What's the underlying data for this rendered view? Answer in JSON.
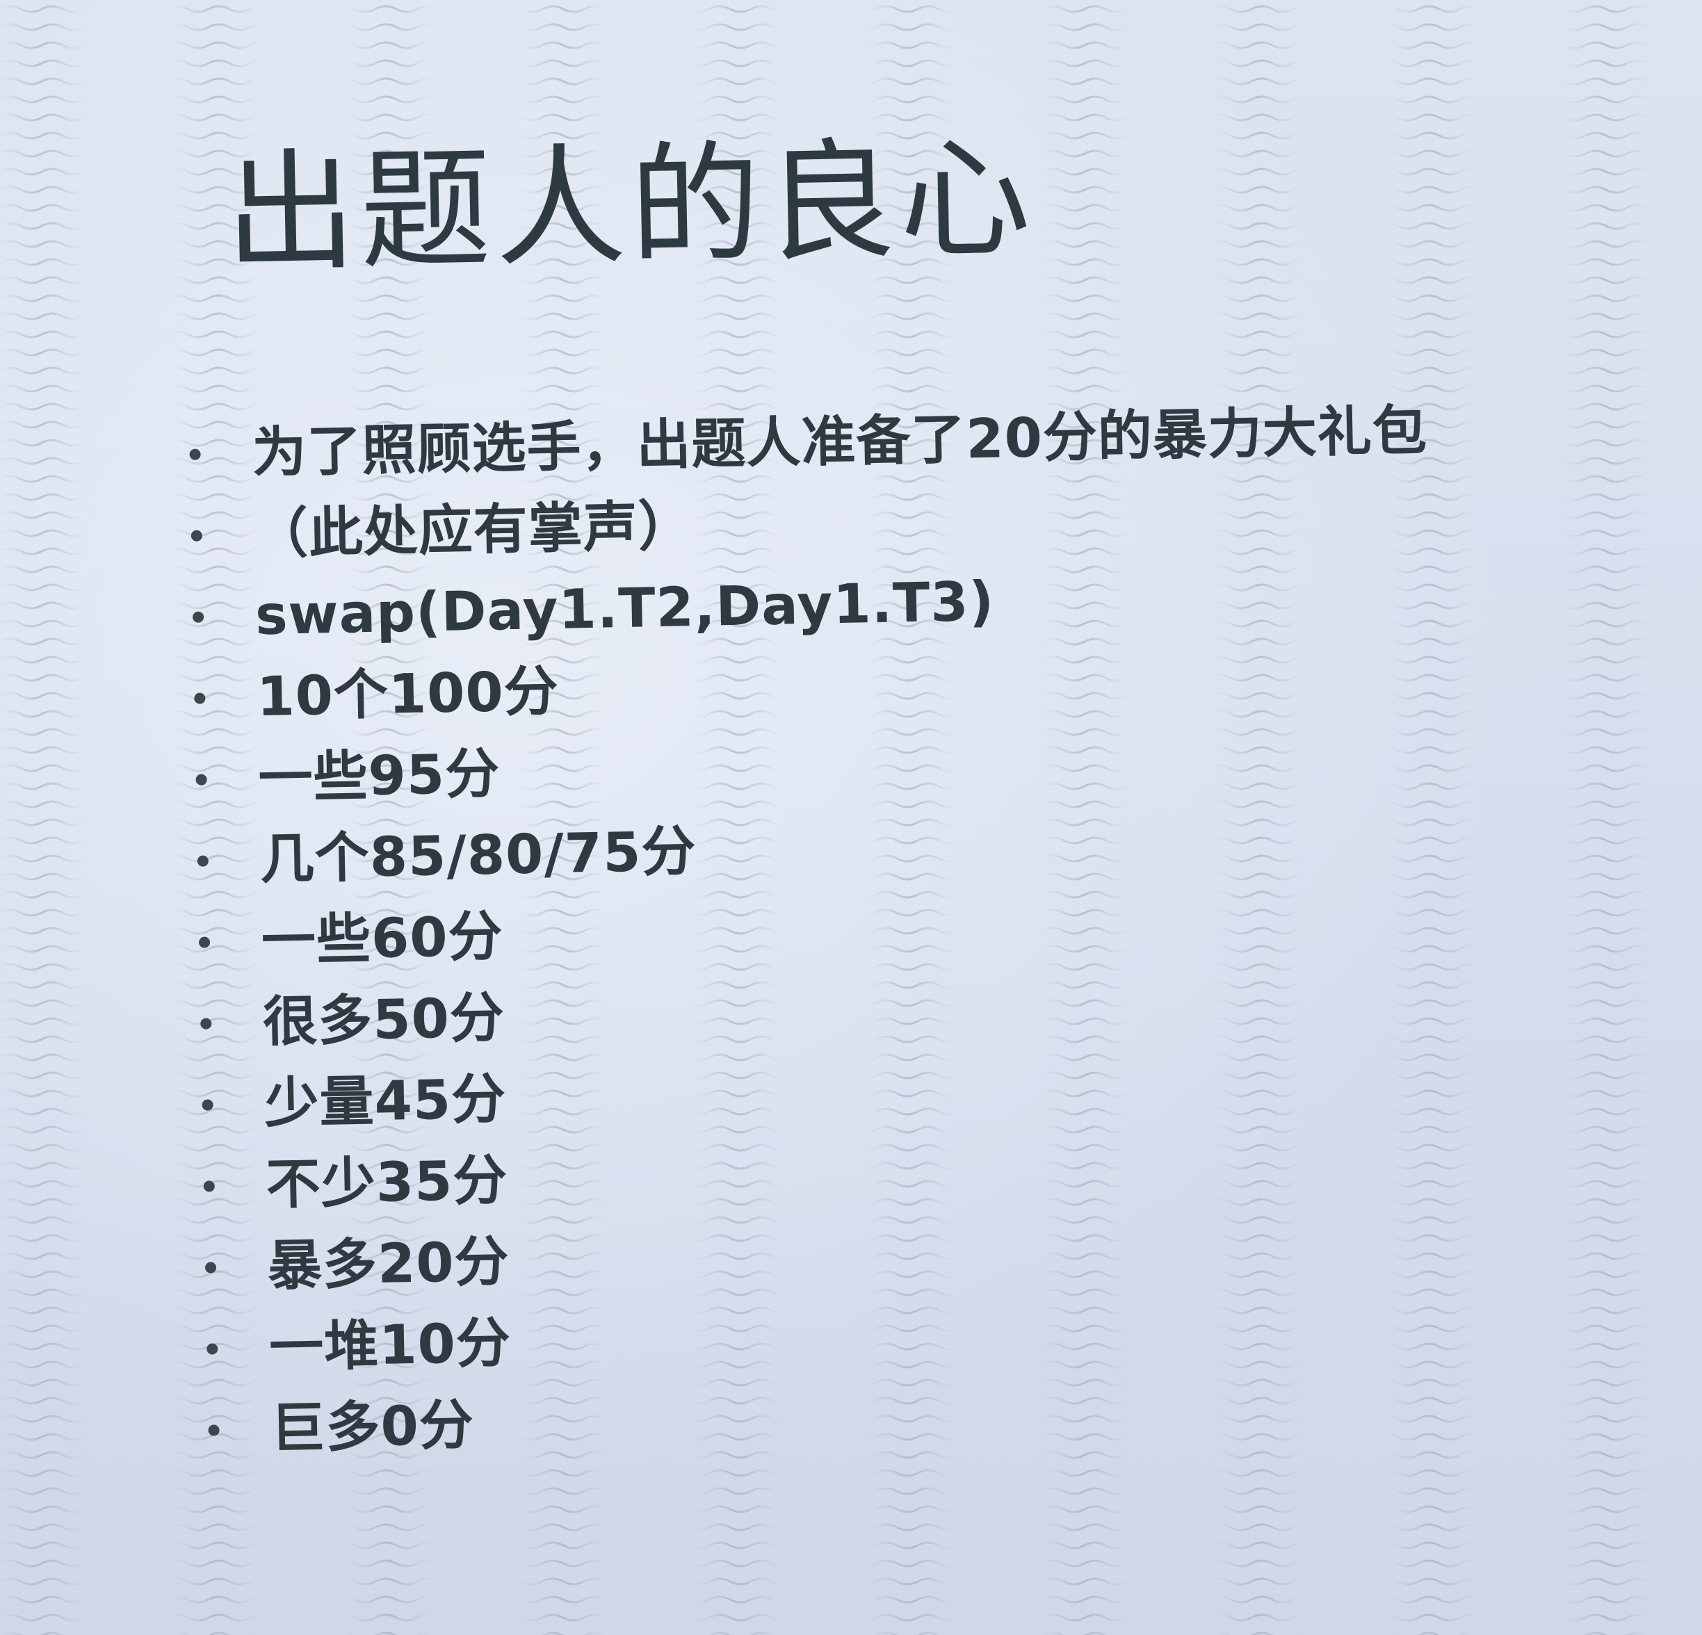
{
  "slide": {
    "title": "出题人的良心",
    "bullets": [
      "为了照顾选手，出题人准备了20分的暴力大礼包",
      "（此处应有掌声）",
      "swap(Day1.T2,Day1.T3)",
      "10个100分",
      "一些95分",
      "几个85/80/75分",
      "一些60分",
      "很多50分",
      "少量45分",
      "不少35分",
      "暴多20分",
      "一堆10分",
      "巨多0分"
    ]
  },
  "colors": {
    "background": "#d9e1ef",
    "text": "#2f3a40",
    "moire": "#9aa5b4"
  }
}
